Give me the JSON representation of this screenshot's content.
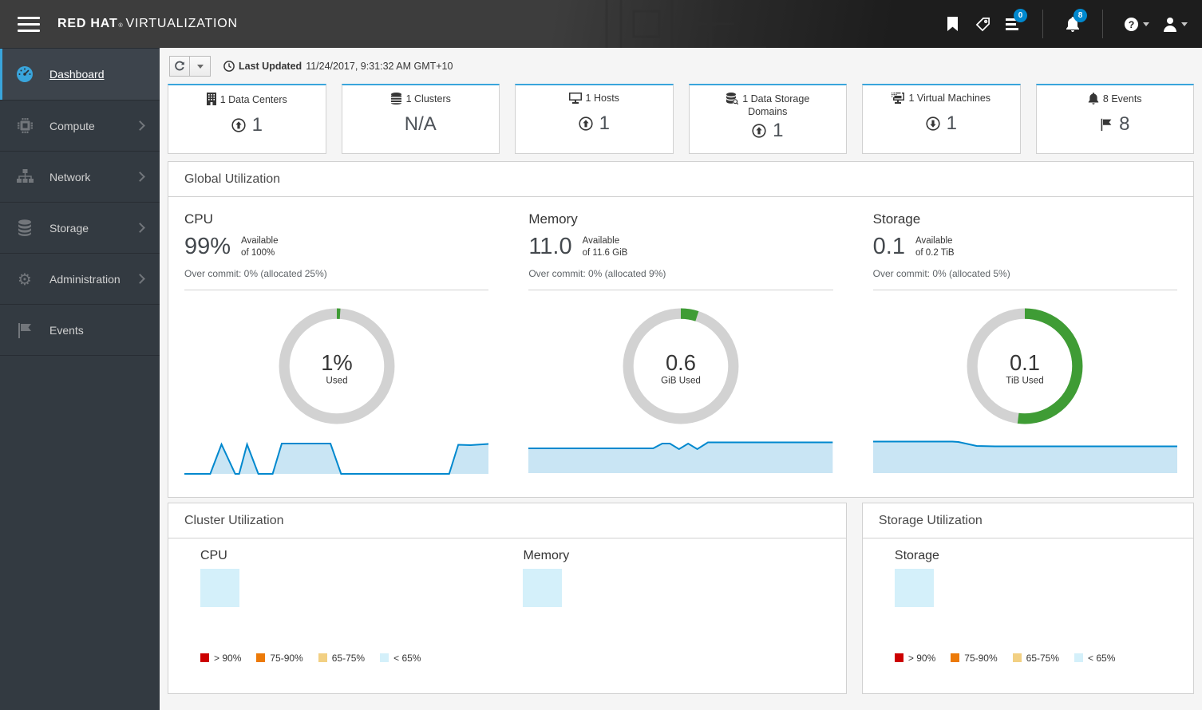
{
  "masthead": {
    "brand_bold": "RED HAT",
    "brand_reg": "®",
    "brand_rest": "VIRTUALIZATION",
    "tasks_badge": "0",
    "notifications_badge": "8"
  },
  "sidebar": {
    "items": [
      {
        "label": "Dashboard"
      },
      {
        "label": "Compute"
      },
      {
        "label": "Network"
      },
      {
        "label": "Storage"
      },
      {
        "label": "Administration"
      },
      {
        "label": "Events"
      }
    ]
  },
  "toolbar": {
    "last_updated_label": "Last Updated",
    "last_updated_value": "11/24/2017, 9:31:32 AM GMT+10"
  },
  "summary_cards": [
    {
      "title": "1 Data Centers",
      "value": "1",
      "trend": "up"
    },
    {
      "title": "1 Clusters",
      "value": "N/A",
      "trend": "none"
    },
    {
      "title": "1 Hosts",
      "value": "1",
      "trend": "up"
    },
    {
      "title": "1 Data Storage Domains",
      "value": "1",
      "trend": "up"
    },
    {
      "title": "1 Virtual Machines",
      "value": "1",
      "trend": "down"
    },
    {
      "title": "8 Events",
      "value": "8",
      "trend": "flag"
    }
  ],
  "global_utilization": {
    "title": "Global Utilization",
    "columns": [
      {
        "name": "CPU",
        "big": "99%",
        "avail_line1": "Available",
        "avail_line2": "of 100%",
        "overcommit": "Over commit: 0% (allocated 25%)"
      },
      {
        "name": "Memory",
        "big": "11.0",
        "avail_line1": "Available",
        "avail_line2": "of 11.6 GiB",
        "overcommit": "Over commit: 0% (allocated 9%)"
      },
      {
        "name": "Storage",
        "big": "0.1",
        "avail_line1": "Available",
        "avail_line2": "of 0.2 TiB",
        "overcommit": "Over commit: 0% (allocated 5%)"
      }
    ]
  },
  "cluster_utilization": {
    "title": "Cluster Utilization",
    "col1": "CPU",
    "col2": "Memory"
  },
  "storage_utilization": {
    "title": "Storage Utilization",
    "col1": "Storage"
  },
  "heat_legend": [
    {
      "label": "> 90%",
      "color": "#cc0000"
    },
    {
      "label": "75-90%",
      "color": "#ec7a08"
    },
    {
      "label": "65-75%",
      "color": "#f2d083"
    },
    {
      "label": "< 65%",
      "color": "#d4f0fa"
    }
  ],
  "colors": {
    "accent_blue": "#39a5dc",
    "pf_blue": "#0088ce",
    "donut_green": "#3f9c35",
    "donut_track": "#d2d2d2",
    "spark_line": "#0088ce",
    "spark_fill": "#c9e5f4"
  },
  "chart_data": [
    {
      "type": "donut",
      "name": "global-cpu-donut",
      "used_pct": 1,
      "total_pct": 100,
      "center_text": "1%",
      "center_label": "Used",
      "color": "#3f9c35",
      "track_color": "#d2d2d2"
    },
    {
      "type": "donut",
      "name": "global-memory-donut",
      "used_pct": 5,
      "used_gib": 0.6,
      "total_gib": 11.6,
      "center_text": "0.6",
      "center_label": "GiB Used",
      "color": "#3f9c35",
      "track_color": "#d2d2d2"
    },
    {
      "type": "donut",
      "name": "global-storage-donut",
      "used_pct": 52,
      "used_tib": 0.1,
      "total_tib": 0.2,
      "center_text": "0.1",
      "center_label": "TiB Used",
      "color": "#3f9c35",
      "track_color": "#d2d2d2"
    },
    {
      "type": "sparkline",
      "name": "cpu-history",
      "color": "#0088ce",
      "fill_color": "#c9e5f4",
      "fill_base": 47,
      "points": [
        [
          0,
          47
        ],
        [
          8.5,
          47
        ],
        [
          12.2,
          10
        ],
        [
          16.7,
          47
        ],
        [
          18,
          47
        ],
        [
          20.6,
          10
        ],
        [
          24.3,
          47
        ],
        [
          29,
          47
        ],
        [
          32,
          9
        ],
        [
          48,
          9
        ],
        [
          51.5,
          47
        ],
        [
          87,
          47
        ],
        [
          90,
          10.5
        ],
        [
          94,
          11
        ],
        [
          100,
          9.5
        ]
      ]
    },
    {
      "type": "sparkline",
      "name": "memory-history",
      "color": "#0088ce",
      "fill_color": "#c9e5f4",
      "fill_base": 46,
      "points": [
        [
          0,
          15
        ],
        [
          41,
          15
        ],
        [
          44,
          9
        ],
        [
          46.5,
          9
        ],
        [
          49.5,
          16
        ],
        [
          52.5,
          9
        ],
        [
          55.5,
          16
        ],
        [
          59,
          7.5
        ],
        [
          64,
          7.5
        ],
        [
          100,
          7.5
        ]
      ]
    },
    {
      "type": "sparkline",
      "name": "storage-history",
      "color": "#0088ce",
      "fill_color": "#c9e5f4",
      "fill_base": 46,
      "points": [
        [
          0,
          6.5
        ],
        [
          26,
          6.5
        ],
        [
          28,
          7
        ],
        [
          34,
          12
        ],
        [
          40,
          12.5
        ],
        [
          100,
          12.5
        ]
      ]
    }
  ]
}
